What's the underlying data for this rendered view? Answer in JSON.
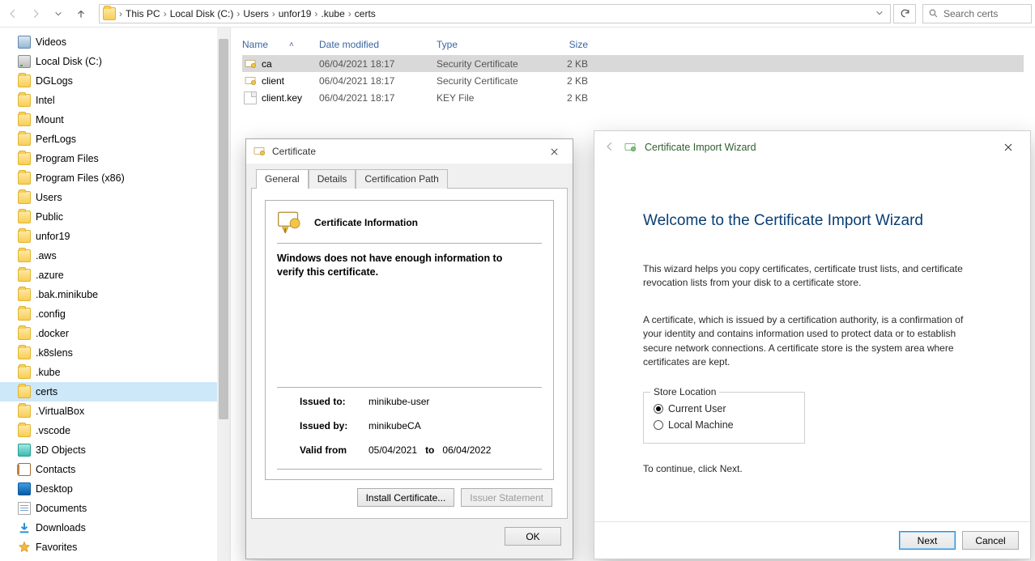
{
  "breadcrumbs": [
    "This PC",
    "Local Disk (C:)",
    "Users",
    "unfor19",
    ".kube",
    "certs"
  ],
  "search_placeholder": "Search certs",
  "tree": {
    "videos": "Videos",
    "local_disk": "Local Disk (C:)",
    "dglogs": "DGLogs",
    "intel": "Intel",
    "mount": "Mount",
    "perflogs": "PerfLogs",
    "program_files": "Program Files",
    "program_files_x86": "Program Files (x86)",
    "users": "Users",
    "public": "Public",
    "unfor19": "unfor19",
    "aws": ".aws",
    "azure": ".azure",
    "bak_minikube": ".bak.minikube",
    "config": ".config",
    "docker": ".docker",
    "k8slens": ".k8slens",
    "kube": ".kube",
    "certs": "certs",
    "virtualbox": ".VirtualBox",
    "vscode": ".vscode",
    "objects3d": "3D Objects",
    "contacts": "Contacts",
    "desktop": "Desktop",
    "documents": "Documents",
    "downloads": "Downloads",
    "favorites": "Favorites"
  },
  "columns": {
    "name": "Name",
    "date": "Date modified",
    "type": "Type",
    "size": "Size"
  },
  "files": [
    {
      "name": "ca",
      "date": "06/04/2021 18:17",
      "type": "Security Certificate",
      "size": "2 KB"
    },
    {
      "name": "client",
      "date": "06/04/2021 18:17",
      "type": "Security Certificate",
      "size": "2 KB"
    },
    {
      "name": "client.key",
      "date": "06/04/2021 18:17",
      "type": "KEY File",
      "size": "2 KB"
    }
  ],
  "cert_dialog": {
    "title": "Certificate",
    "tabs": {
      "general": "General",
      "details": "Details",
      "certpath": "Certification Path"
    },
    "heading": "Certificate Information",
    "message": "Windows does not have enough information to verify this certificate.",
    "issued_to_label": "Issued to:",
    "issued_to": "minikube-user",
    "issued_by_label": "Issued by:",
    "issued_by": "minikubeCA",
    "valid_label": "Valid from",
    "valid_from": "05/04/2021",
    "valid_to_word": "to",
    "valid_to": "06/04/2022",
    "install_btn": "Install Certificate...",
    "issuer_btn": "Issuer Statement",
    "ok": "OK"
  },
  "wizard": {
    "app_title": "Certificate Import Wizard",
    "heading": "Welcome to the Certificate Import Wizard",
    "p1": "This wizard helps you copy certificates, certificate trust lists, and certificate revocation lists from your disk to a certificate store.",
    "p2": "A certificate, which is issued by a certification authority, is a confirmation of your identity and contains information used to protect data or to establish secure network connections. A certificate store is the system area where certificates are kept.",
    "store_legend": "Store Location",
    "opt_user": "Current User",
    "opt_machine": "Local Machine",
    "continue_hint": "To continue, click Next.",
    "next": "Next",
    "cancel": "Cancel"
  }
}
